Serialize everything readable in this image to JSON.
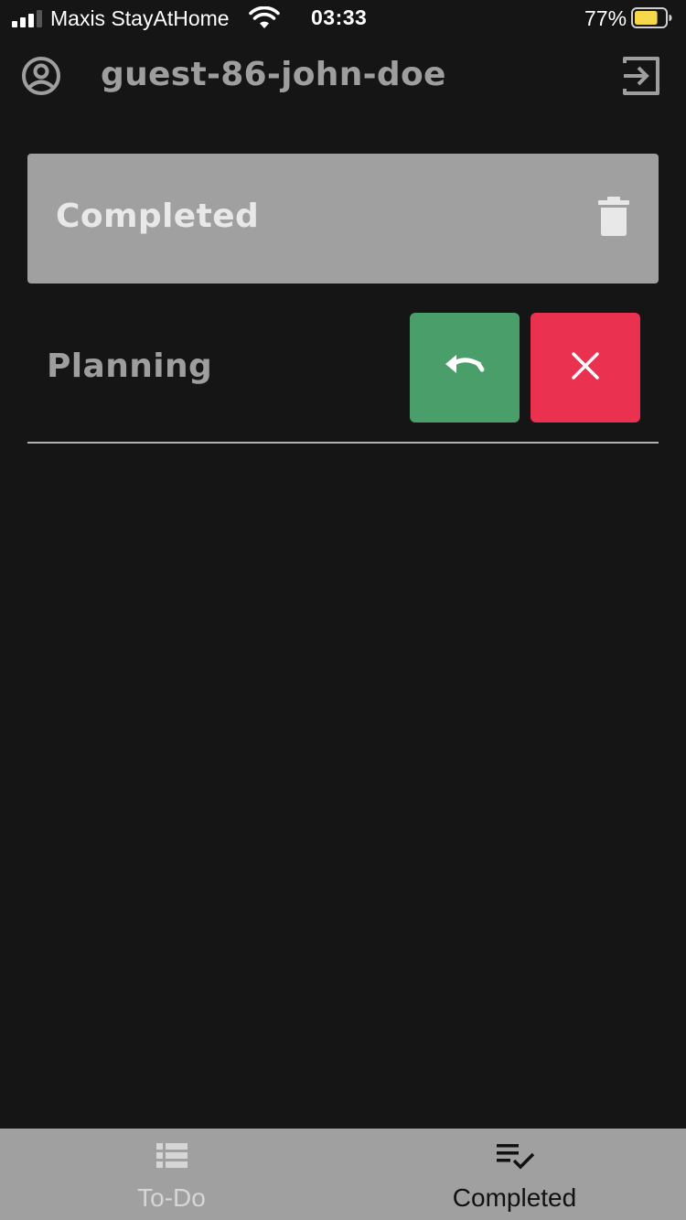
{
  "status_bar": {
    "carrier": "Maxis StayAtHome",
    "time": "03:33",
    "battery_percent": "77%",
    "battery_level": 0.77,
    "battery_color": "#f5d94a"
  },
  "header": {
    "username": "guest-86-john-doe",
    "account_icon": "account-circle-icon",
    "logout_icon": "logout-icon"
  },
  "section": {
    "title": "Completed",
    "delete_icon": "trash-icon"
  },
  "tasks": [
    {
      "label": "Planning",
      "undo_icon": "undo-icon",
      "delete_icon": "close-icon"
    }
  ],
  "tabs": [
    {
      "label": "To-Do",
      "icon": "list-icon",
      "active": false
    },
    {
      "label": "Completed",
      "icon": "playlist-check-icon",
      "active": true
    }
  ],
  "colors": {
    "background": "#151515",
    "card": "#a0a0a0",
    "undo_button": "#4a9e69",
    "delete_button": "#ea314f",
    "tabbar": "#a0a0a0"
  }
}
